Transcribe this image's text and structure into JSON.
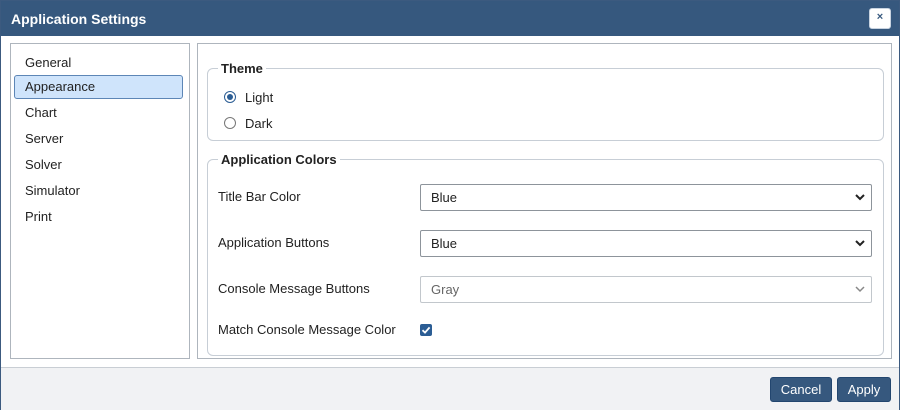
{
  "window": {
    "title": "Application Settings",
    "close_glyph": "×"
  },
  "nav": {
    "items": [
      {
        "label": "General"
      },
      {
        "label": "Appearance",
        "active": true
      },
      {
        "label": "Chart"
      },
      {
        "label": "Server"
      },
      {
        "label": "Solver"
      },
      {
        "label": "Simulator"
      },
      {
        "label": "Print"
      }
    ]
  },
  "theme": {
    "legend": "Theme",
    "options": [
      {
        "label": "Light",
        "selected": true
      },
      {
        "label": "Dark",
        "selected": false
      }
    ]
  },
  "colors": {
    "legend": "Application Colors",
    "title_bar": {
      "label": "Title Bar Color",
      "value": "Blue"
    },
    "app_buttons": {
      "label": "Application Buttons",
      "value": "Blue"
    },
    "console_buttons": {
      "label": "Console Message Buttons",
      "value": "Gray",
      "disabled": true
    },
    "match_console": {
      "label": "Match Console Message Color",
      "checked": true
    }
  },
  "footer": {
    "cancel_label": "Cancel",
    "apply_label": "Apply"
  },
  "style": {
    "accent": "#36587e",
    "selected_bg": "#cfe4fb",
    "check_color": "#2b5d94"
  }
}
